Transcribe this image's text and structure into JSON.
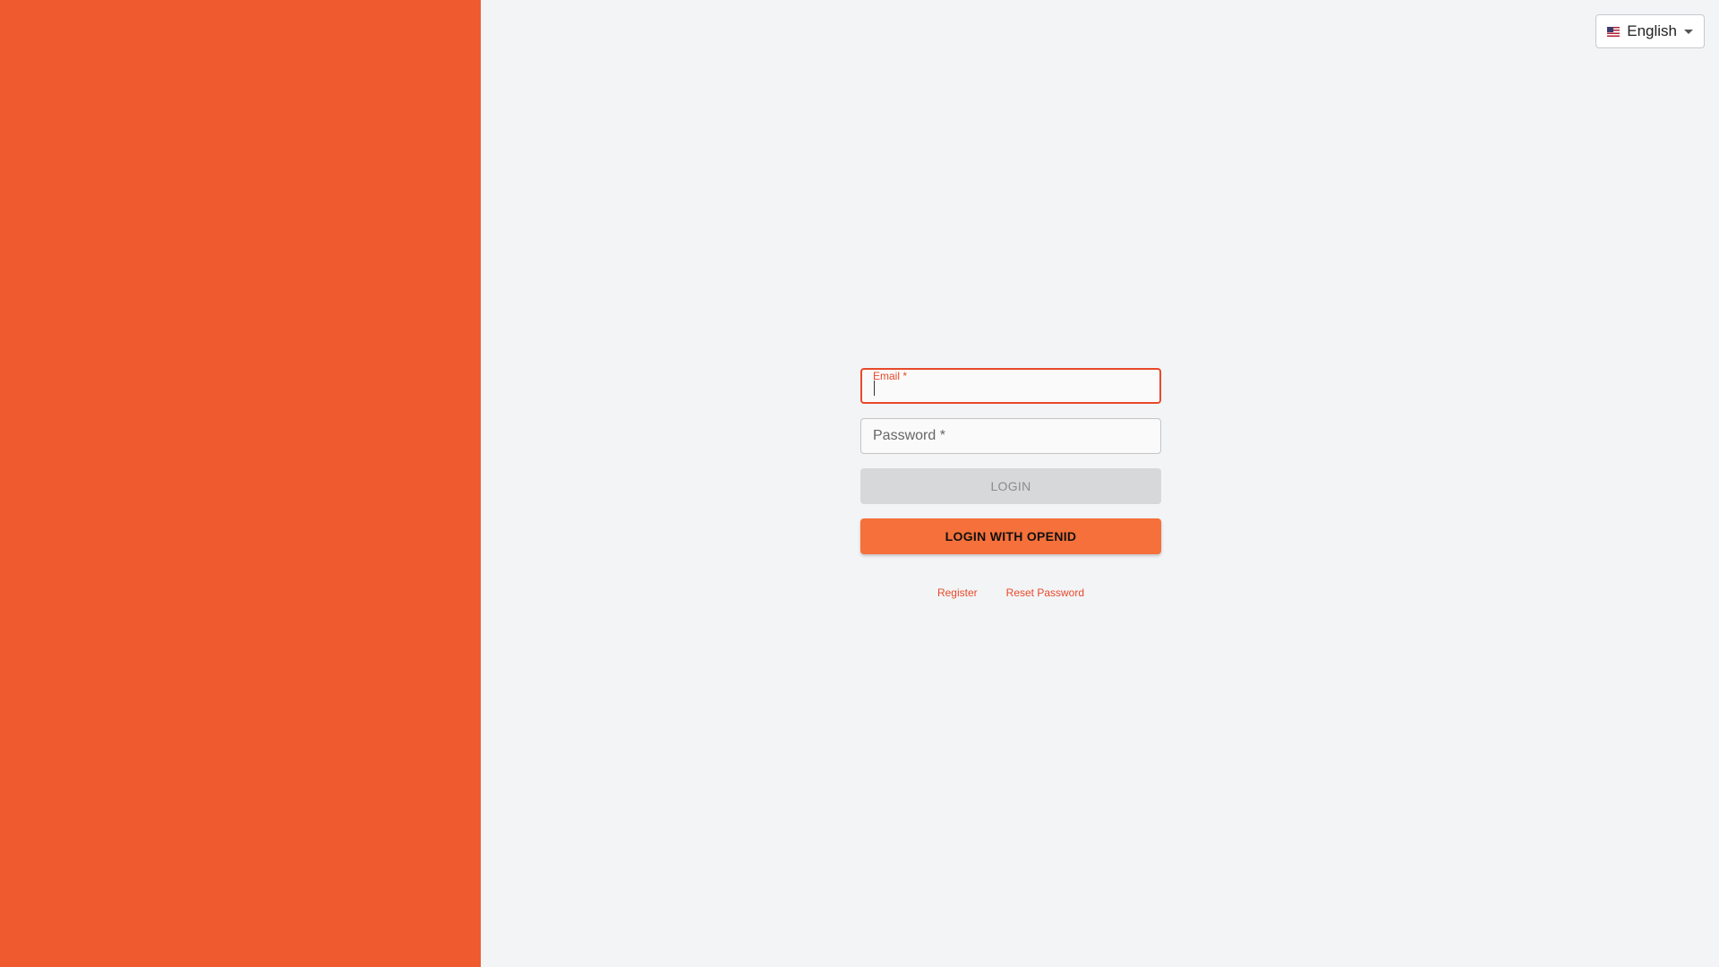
{
  "theme": {
    "accent": "#f05a2f",
    "button_accent": "#f5703a",
    "background": "#f3f4f6"
  },
  "language_selector": {
    "flag_icon": "us-flag-icon",
    "selected": "English"
  },
  "login_form": {
    "email_label": "Email *",
    "email_value": "",
    "password_placeholder": "Password *",
    "password_value": "",
    "login_button": "LOGIN",
    "openid_button": "LOGIN WITH OPENID"
  },
  "links": {
    "register": "Register",
    "reset_password": "Reset Password"
  }
}
